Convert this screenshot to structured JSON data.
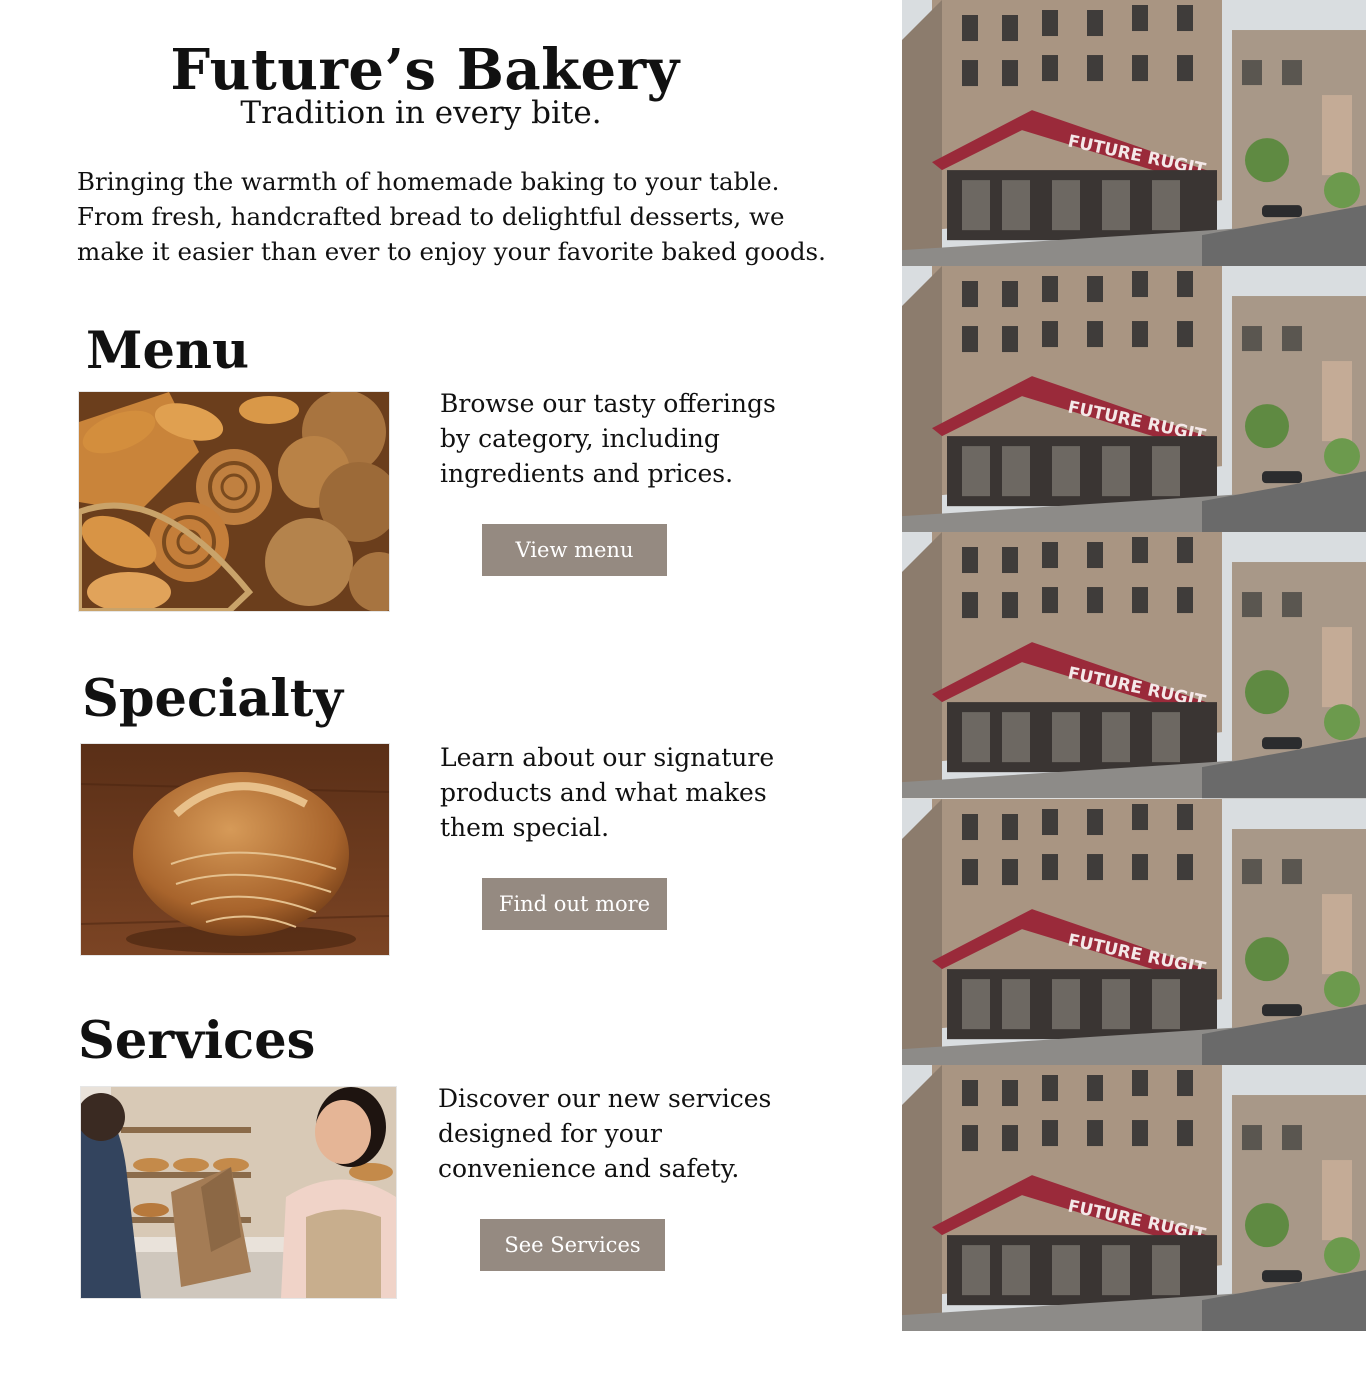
{
  "header": {
    "title": "Future’s Bakery",
    "tagline": "Tradition in every bite.",
    "intro": "Bringing the warmth of homemade baking to your table. From fresh, handcrafted bread to delightful desserts, we make it easier than ever to enjoy your favorite baked goods."
  },
  "sections": [
    {
      "heading": "Menu",
      "description": "Browse our tasty offerings by category, including ingredients and prices.",
      "button_label": "View menu",
      "image": "pastry-basket-photo"
    },
    {
      "heading": "Specialty",
      "description": "Learn about our signature products and what makes them special.",
      "button_label": "Find out more",
      "image": "sourdough-loaf-photo"
    },
    {
      "heading": "Services",
      "description": "Discover our new services designed for your convenience and safety.",
      "button_label": "See Services",
      "image": "counter-service-photo"
    }
  ],
  "storefront_gallery": {
    "tile_count": 5,
    "awning_text": "FUTURE RUGIT",
    "image": "bakery-storefront-photo"
  },
  "colors": {
    "button_bg": "#958a81",
    "button_text": "#ffffff",
    "awning": "#9a2a3a"
  }
}
